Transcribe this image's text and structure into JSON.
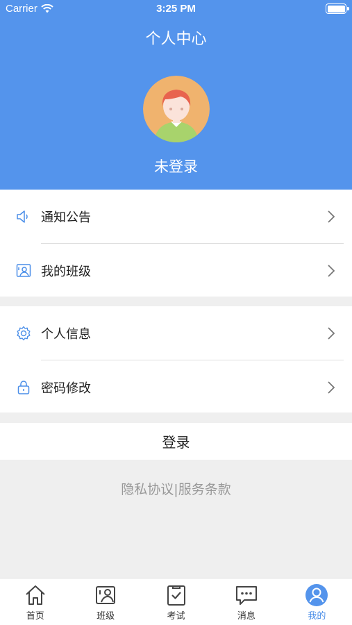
{
  "status_bar": {
    "carrier": "Carrier",
    "time": "3:25 PM"
  },
  "header": {
    "title": "个人中心",
    "user_name": "未登录"
  },
  "menu_group_1": [
    {
      "label": "通知公告",
      "icon": "speaker-icon"
    },
    {
      "label": "我的班级",
      "icon": "class-icon"
    }
  ],
  "menu_group_2": [
    {
      "label": "个人信息",
      "icon": "gear-icon"
    },
    {
      "label": "密码修改",
      "icon": "lock-icon"
    }
  ],
  "login_label": "登录",
  "footer_links": "隐私协议|服务条款",
  "tabs": [
    {
      "label": "首页",
      "icon": "home-icon",
      "active": false
    },
    {
      "label": "班级",
      "icon": "class-board-icon",
      "active": false
    },
    {
      "label": "考试",
      "icon": "exam-icon",
      "active": false
    },
    {
      "label": "消息",
      "icon": "message-icon",
      "active": false
    },
    {
      "label": "我的",
      "icon": "profile-icon",
      "active": true
    }
  ],
  "colors": {
    "header_bg": "#5494ec",
    "accent": "#4a8ee8",
    "page_bg": "#efefef"
  }
}
